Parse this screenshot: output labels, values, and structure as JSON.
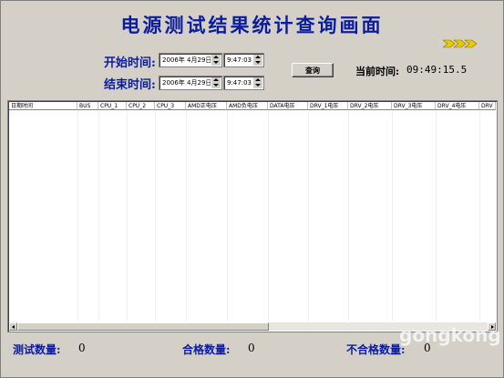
{
  "title": "电源测试结果统计查询画面",
  "start_label": "开始时间:",
  "end_label": "结束时间:",
  "start_date": "2006年 4月29日",
  "start_time": "9:47:03",
  "end_date": "2006年 4月29日",
  "end_time": "9:47:03",
  "query_button": "查询",
  "current_time_label": "当前时间:",
  "current_time_value": "09:49:15.5",
  "columns": [
    "日期时间",
    "BUS",
    "CPU_1",
    "CPU_2",
    "CPU_3",
    "AMD正电压",
    "AMD负电压",
    "DATA电压",
    "DRV_1电压",
    "DRV_2电压",
    "DRV_3电压",
    "DRV_4电压",
    "DRV"
  ],
  "stats": {
    "test_count_label": "测试数量:",
    "test_count_value": "0",
    "pass_count_label": "合格数量:",
    "pass_count_value": "0",
    "fail_count_label": "不合格数量:",
    "fail_count_value": "0"
  },
  "watermark": "gongkong",
  "arrow_color": "#e8c800"
}
